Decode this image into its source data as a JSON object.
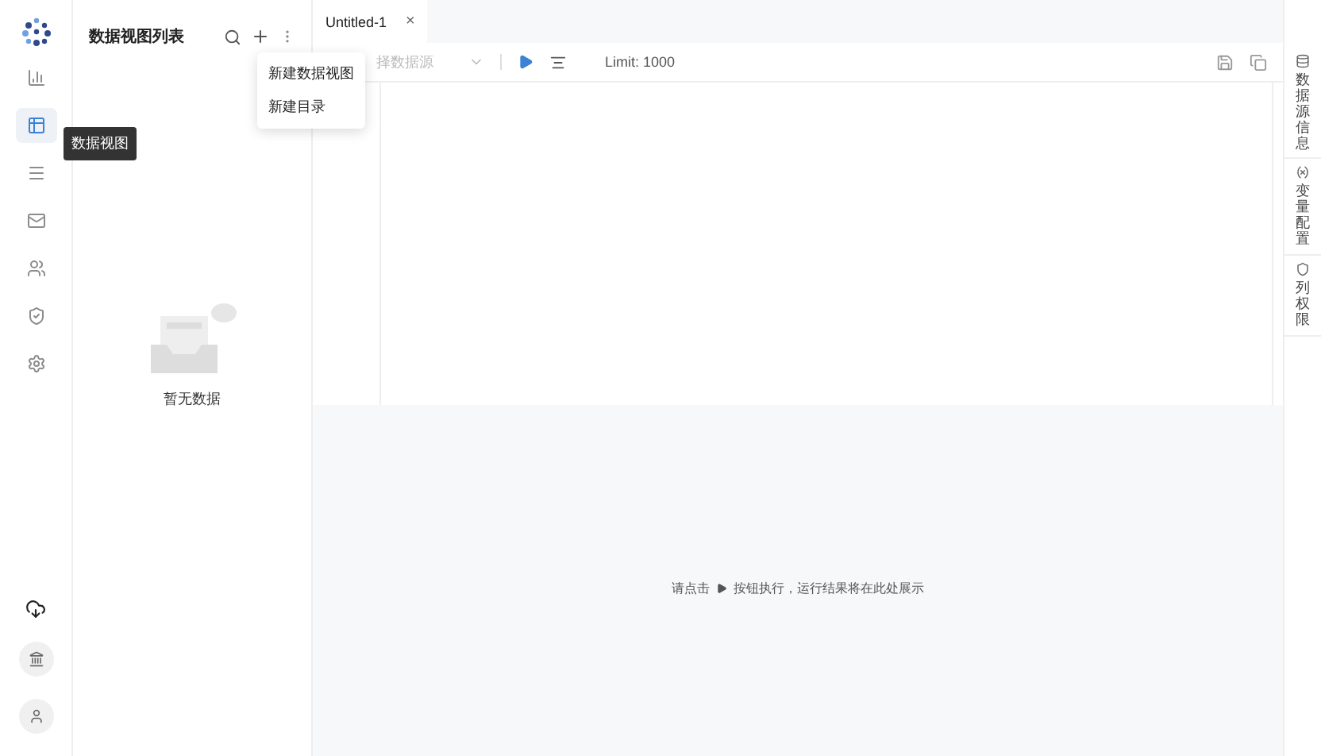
{
  "nav": {
    "items": [
      {
        "selected": false
      },
      {
        "selected": true
      },
      {
        "selected": false
      },
      {
        "selected": false
      },
      {
        "selected": false
      },
      {
        "selected": false
      },
      {
        "selected": false
      }
    ],
    "tooltip": "数据视图"
  },
  "list_panel": {
    "title": "数据视图列表",
    "menu": [
      "新建数据视图",
      "新建目录"
    ],
    "empty": "暂无数据"
  },
  "tabs": [
    {
      "label": "Untitled-1",
      "close": "×",
      "selected": true
    }
  ],
  "toolbar": {
    "source_placeholder": "择数据源",
    "limit": "Limit: 1000"
  },
  "results": {
    "hint_before": "请点击",
    "hint_after": "按钮执行，运行结果将在此处展示"
  },
  "side_tabs": [
    {
      "label": "数据源信息"
    },
    {
      "label": "变量配置"
    },
    {
      "label": "列权限"
    }
  ]
}
